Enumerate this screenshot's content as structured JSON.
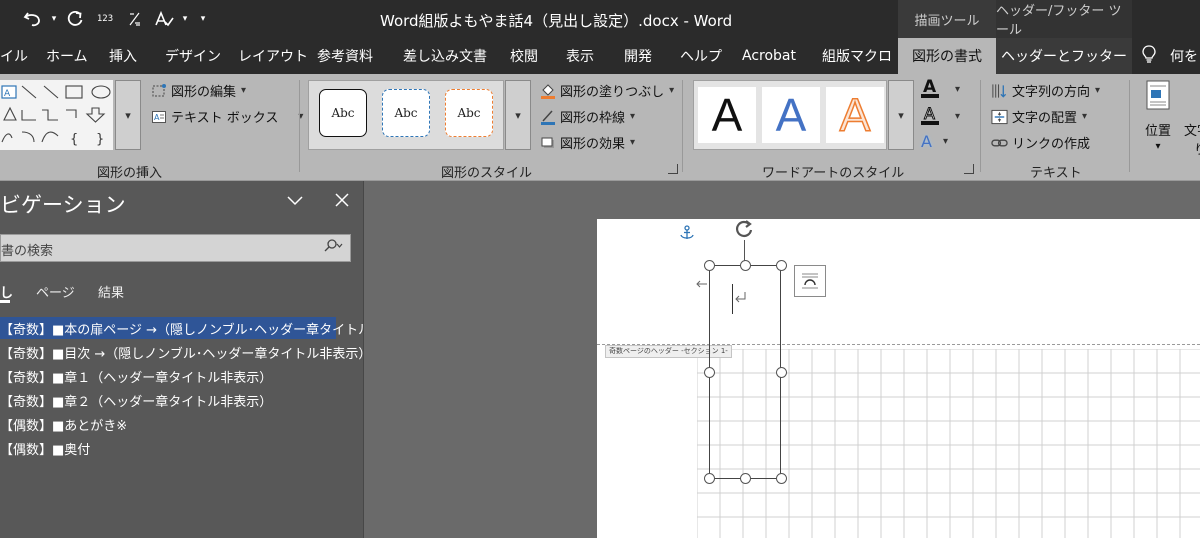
{
  "title_bar": {
    "title": "Word組版よもやま話4（見出し設定）.docx  -  Word",
    "qat": {
      "numbering_label": "123"
    },
    "context_tabs": [
      "描画ツール",
      "ヘッダー/フッター ツール"
    ]
  },
  "ribbon_tabs": [
    "イル",
    "ホーム",
    "挿入",
    "デザイン",
    "レイアウト",
    "参考資料",
    "差し込み文書",
    "校閲",
    "表示",
    "開発",
    "ヘルプ",
    "Acrobat",
    "組版マクロ",
    "図形の書式",
    "ヘッダーとフッター",
    "何を"
  ],
  "active_tab": "図形の書式",
  "ribbon": {
    "insert_shapes": {
      "edit_shape": "図形の編集",
      "text_box": "テキスト ボックス",
      "label": "図形の挿入"
    },
    "shape_styles": {
      "samples": [
        "Abc",
        "Abc",
        "Abc"
      ],
      "fill": "図形の塗りつぶし",
      "outline": "図形の枠線",
      "effects": "図形の効果",
      "label": "図形のスタイル"
    },
    "wordart_styles": {
      "samples": [
        "A",
        "A",
        "A"
      ],
      "text_fill_glyph": "A",
      "label": "ワードアートのスタイル"
    },
    "text": {
      "direction": "文字列の方向",
      "align": "文字の配置",
      "link": "リンクの作成",
      "label": "テキスト"
    },
    "arrange": {
      "position": "位置",
      "wrap": "文字",
      "wrap_second": "り"
    }
  },
  "navigation_pane": {
    "title": "ビゲーション",
    "search_placeholder": "書の検索",
    "tabs": [
      "し",
      "ページ",
      "結果"
    ],
    "headings": [
      "【奇数】■本の扉ページ →（隠しノンブル･ヘッダー章タイトル…",
      "【奇数】■目次 →（隠しノンブル･ヘッダー章タイトル非表示）",
      "【奇数】■章１（ヘッダー章タイトル非表示）",
      "【奇数】■章２（ヘッダー章タイトル非表示）",
      "【偶数】■あとがき※",
      "【偶数】■奥付"
    ]
  },
  "document": {
    "header_tag": "奇数ページのヘッダー -セクション 1-"
  },
  "colors": {
    "titlebar": "#2b2b2b",
    "ribbon": "#b7b7b7",
    "nav_bg": "#585858",
    "selection": "#2f5597",
    "accent_blue": "#2e75b6",
    "accent_orange": "#ed7d31"
  }
}
